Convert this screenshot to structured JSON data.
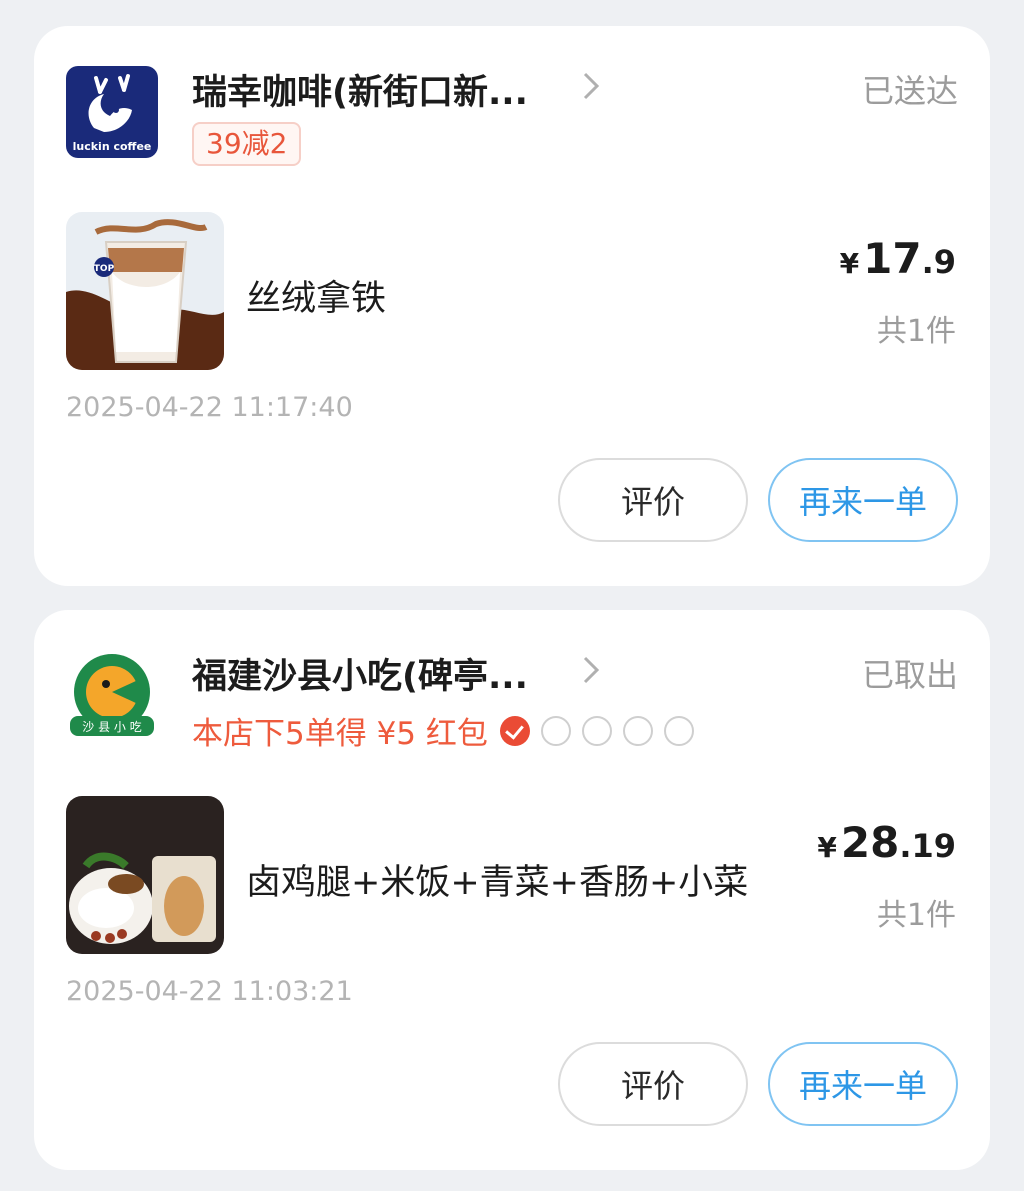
{
  "orders": [
    {
      "shop_name": "瑞幸咖啡(新街口新...",
      "status": "已送达",
      "promo": "39减2",
      "logo_text": "luckin coffee",
      "item_name": "丝绒拿铁",
      "price_currency": "¥",
      "price_int": "17",
      "price_dec": ".9",
      "quantity": "共1件",
      "time": "2025-04-22 11:17:40",
      "review_label": "评价",
      "reorder_label": "再来一单"
    },
    {
      "shop_name": "福建沙县小吃(碑亭...",
      "status": "已取出",
      "promo": "本店下5单得 ¥5 红包",
      "promo_progress": {
        "completed": 1,
        "total": 5
      },
      "item_name": "卤鸡腿+米饭+青菜+香肠+小菜",
      "price_currency": "¥",
      "price_int": "28",
      "price_dec": ".19",
      "quantity": "共1件",
      "time": "2025-04-22 11:03:21",
      "review_label": "评价",
      "reorder_label": "再来一单"
    }
  ],
  "colors": {
    "accent_blue": "#2d97e6",
    "promo_red": "#ee5b3d",
    "luckin_blue": "#1a2a7a",
    "shaxian_green": "#1f8a4a"
  },
  "icons": [
    "chevron-right-icon",
    "luckin-logo",
    "shaxian-logo",
    "check-icon"
  ]
}
